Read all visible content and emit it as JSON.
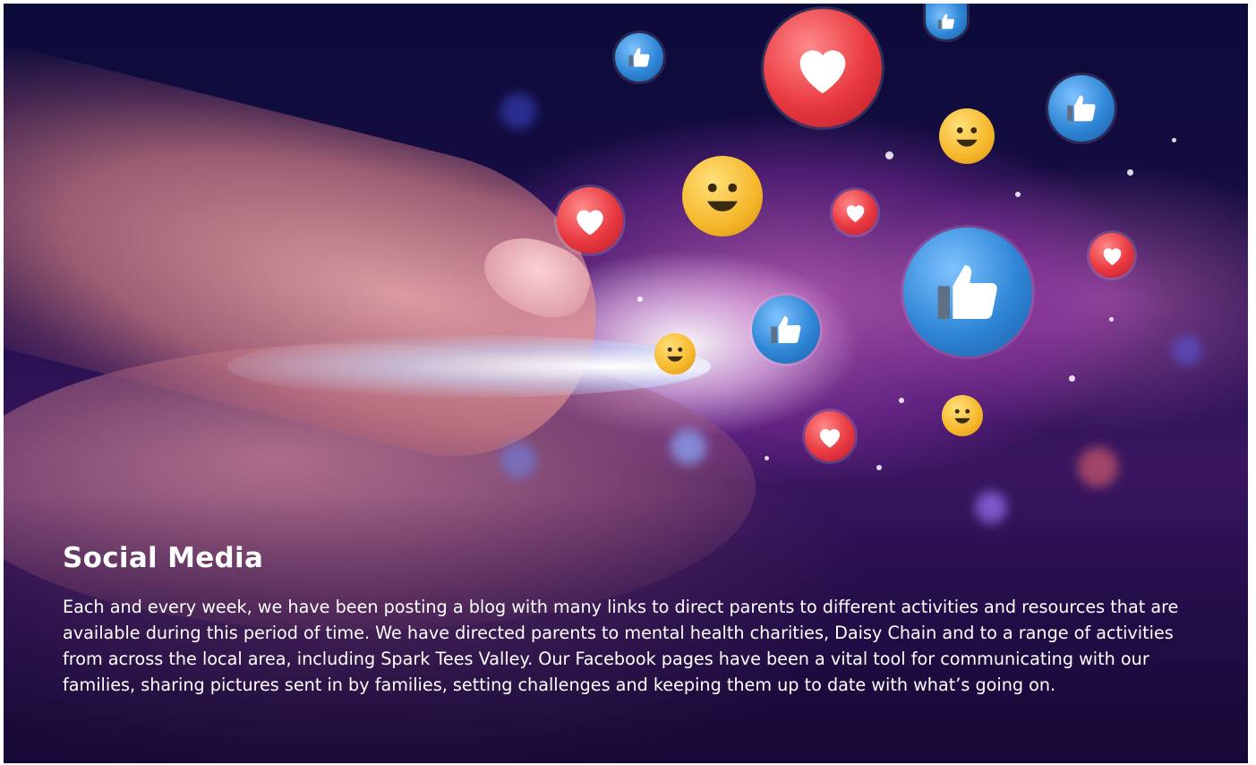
{
  "article": {
    "title": "Social Media",
    "body": "Each and every week, we have been posting a blog with many links to direct parents to different activities and resources that are available during this period of time. We have directed parents to mental health charities, Daisy Chain and to a range of activities from across the local area, including Spark Tees Valley. Our Facebook pages have been a vital tool for communicating with our families, sharing pictures sent in by families, setting challenges and keeping them up to date with what’s going on."
  },
  "hero_image": {
    "icons": [
      "heart-icon",
      "thumbs-up-icon",
      "smiley-icon"
    ],
    "colors": {
      "heart": "#e8383f",
      "like": "#2f86d6",
      "smile": "#f5b72a",
      "background": "#1a0d45"
    }
  }
}
